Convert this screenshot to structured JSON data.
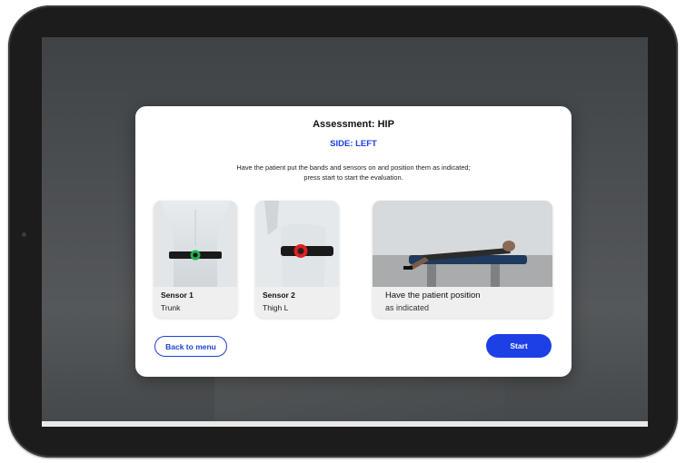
{
  "modal": {
    "title": "Assessment: HIP",
    "side": "SIDE: LEFT",
    "instruction_line1": "Have the patient put the bands and sensors on and position them as indicated;",
    "instruction_line2": "press start to start the evaluation."
  },
  "cards": [
    {
      "title": "Sensor 1",
      "subtitle": "Trunk",
      "sensor_color": "#22b14c",
      "icon": "sensor-band-icon"
    },
    {
      "title": "Sensor 2",
      "subtitle": "Thigh L",
      "sensor_color": "#e02020",
      "icon": "sensor-band-icon"
    },
    {
      "title": "Have the patient position",
      "subtitle": "as indicated",
      "icon": "patient-position-photo"
    }
  ],
  "buttons": {
    "back": "Back to menu",
    "start": "Start"
  },
  "colors": {
    "accent": "#1c3fe6",
    "side_text": "#1a40e0",
    "backdrop": "#4e5154"
  }
}
